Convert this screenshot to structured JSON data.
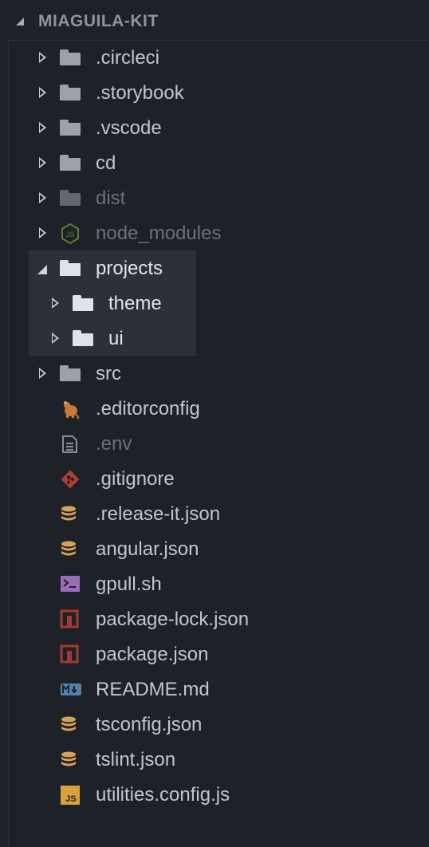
{
  "explorer": {
    "title": "MIAGUILA-KIT",
    "items": [
      {
        "label": ".circleci",
        "kind": "folder",
        "state": "collapsed",
        "icon": "folder-icon"
      },
      {
        "label": ".storybook",
        "kind": "folder",
        "state": "collapsed",
        "icon": "folder-icon"
      },
      {
        "label": ".vscode",
        "kind": "folder",
        "state": "collapsed",
        "icon": "folder-icon"
      },
      {
        "label": "cd",
        "kind": "folder",
        "state": "collapsed",
        "icon": "folder-icon"
      },
      {
        "label": "dist",
        "kind": "folder",
        "state": "collapsed",
        "dimmed": true,
        "icon": "folder-icon"
      },
      {
        "label": "node_modules",
        "kind": "folder",
        "state": "collapsed",
        "dimmed": true,
        "icon": "nodejs-icon"
      },
      {
        "label": "projects",
        "kind": "folder",
        "state": "expanded",
        "selected": true,
        "icon": "folder-open-icon"
      },
      {
        "label": "theme",
        "kind": "folder",
        "state": "collapsed",
        "indent": 1,
        "icon": "folder-icon"
      },
      {
        "label": "ui",
        "kind": "folder",
        "state": "collapsed",
        "indent": 1,
        "icon": "folder-icon"
      },
      {
        "label": "src",
        "kind": "folder",
        "state": "collapsed",
        "icon": "folder-icon"
      },
      {
        "label": ".editorconfig",
        "kind": "file",
        "icon": "editorconfig-rat-icon"
      },
      {
        "label": ".env",
        "kind": "file",
        "dimmed": true,
        "icon": "document-icon"
      },
      {
        "label": ".gitignore",
        "kind": "file",
        "icon": "git-icon"
      },
      {
        "label": ".release-it.json",
        "kind": "file",
        "icon": "database-icon"
      },
      {
        "label": "angular.json",
        "kind": "file",
        "icon": "database-icon"
      },
      {
        "label": "gpull.sh",
        "kind": "file",
        "icon": "terminal-icon"
      },
      {
        "label": "package-lock.json",
        "kind": "file",
        "icon": "npm-icon"
      },
      {
        "label": "package.json",
        "kind": "file",
        "icon": "npm-icon"
      },
      {
        "label": "README.md",
        "kind": "file",
        "icon": "markdown-icon"
      },
      {
        "label": "tsconfig.json",
        "kind": "file",
        "icon": "database-icon"
      },
      {
        "label": "tslint.json",
        "kind": "file",
        "icon": "database-icon"
      },
      {
        "label": "utilities.config.js",
        "kind": "file",
        "icon": "javascript-icon"
      }
    ]
  },
  "colors": {
    "background": "#1e2127",
    "selection": "#2b3039",
    "text": "#c3c6cb",
    "text_dim": "#6c7079",
    "folder": "#9ea2a8",
    "json": "#d7a15b",
    "git": "#b13e34",
    "npm": "#a33a34",
    "terminal": "#b07fc7",
    "markdown": "#5c8fb8",
    "js": "#d9a13d",
    "node": "#6b9a3c"
  }
}
